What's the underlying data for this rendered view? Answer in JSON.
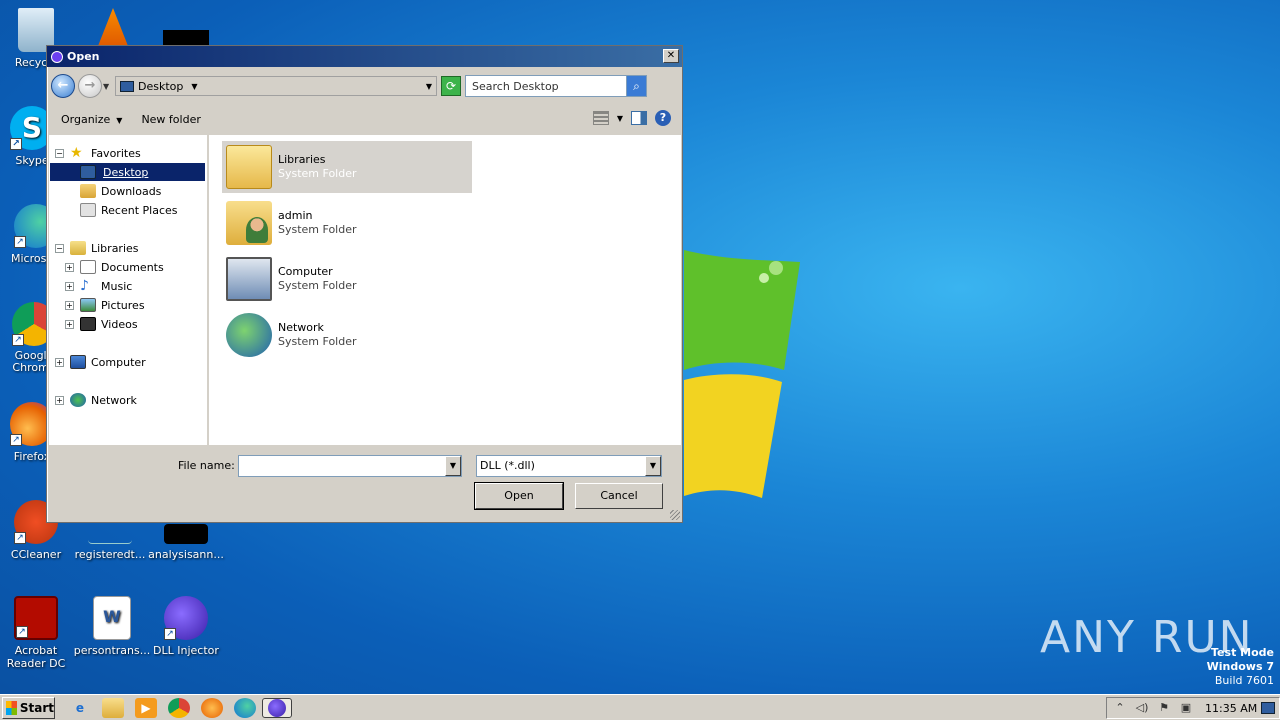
{
  "desktop": {
    "icons": [
      {
        "label": "Recycle",
        "icon": "recycle-bin-icon"
      },
      {
        "label": "Skype",
        "icon": "skype-icon"
      },
      {
        "label": "Microsoft",
        "icon": "edge-icon"
      },
      {
        "label": "Google Chrome",
        "icon": "chrome-icon"
      },
      {
        "label": "Firefox",
        "icon": "firefox-icon"
      },
      {
        "label": "CCleaner",
        "icon": "ccleaner-icon"
      },
      {
        "label": "registeredt...",
        "icon": "file-icon"
      },
      {
        "label": "analysisann...",
        "icon": "file-icon"
      },
      {
        "label": "Acrobat Reader DC",
        "icon": "acrobat-icon"
      },
      {
        "label": "persontrans...",
        "icon": "word-document-icon"
      },
      {
        "label": "DLL Injector",
        "icon": "dll-injector-icon"
      }
    ],
    "watermark": "ANY RUN",
    "test_mode": {
      "line1": "Test Mode",
      "line2": "Windows 7",
      "line3": "Build 7601"
    }
  },
  "dialog": {
    "title": "Open",
    "close_label": "✕",
    "address": {
      "location": "Desktop"
    },
    "search_placeholder": "Search Desktop",
    "toolbar": {
      "organize": "Organize",
      "new_folder": "New folder"
    },
    "nav_tree": [
      {
        "label": "Favorites",
        "icon": "star-icon"
      },
      {
        "label": "Desktop",
        "icon": "desktop-icon",
        "selected": true
      },
      {
        "label": "Downloads",
        "icon": "downloads-icon"
      },
      {
        "label": "Recent Places",
        "icon": "recent-places-icon"
      },
      {
        "label": "Libraries",
        "icon": "libraries-icon"
      },
      {
        "label": "Documents",
        "icon": "documents-icon"
      },
      {
        "label": "Music",
        "icon": "music-icon"
      },
      {
        "label": "Pictures",
        "icon": "pictures-icon"
      },
      {
        "label": "Videos",
        "icon": "videos-icon"
      },
      {
        "label": "Computer",
        "icon": "computer-icon"
      },
      {
        "label": "Network",
        "icon": "network-icon"
      }
    ],
    "files": [
      {
        "name": "Libraries",
        "type": "System Folder",
        "icon": "libraries-folder-icon",
        "selected": true
      },
      {
        "name": "admin",
        "type": "System Folder",
        "icon": "user-folder-icon"
      },
      {
        "name": "Computer",
        "type": "System Folder",
        "icon": "computer-icon"
      },
      {
        "name": "Network",
        "type": "System Folder",
        "icon": "network-icon"
      }
    ],
    "file_name_label": "File name:",
    "file_name_value": "",
    "file_type": "DLL (*.dll)",
    "open_label": "Open",
    "cancel_label": "Cancel"
  },
  "taskbar": {
    "start_label": "Start",
    "pinned": [
      "internet-explorer-icon",
      "explorer-icon",
      "media-player-icon",
      "chrome-icon",
      "firefox-icon",
      "edge-icon",
      "dll-injector-icon"
    ],
    "clock": "11:35 AM"
  }
}
